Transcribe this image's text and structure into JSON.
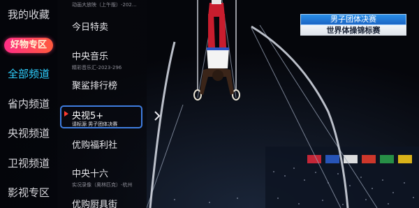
{
  "categories": [
    {
      "label": "我的收藏",
      "active": false
    },
    {
      "label": "全部频道",
      "active": true
    },
    {
      "label": "省内频道",
      "active": false
    },
    {
      "label": "央视频道",
      "active": false
    },
    {
      "label": "卫视频道",
      "active": false
    },
    {
      "label": "影视专区",
      "active": false
    }
  ],
  "goods_badge": {
    "label": "好物专区"
  },
  "channel_list": {
    "top_sub": "动画大放映（上午版）-202...",
    "items": [
      {
        "name": "今日特卖",
        "sub": ""
      },
      {
        "name": "中央音乐",
        "sub": "精彩音乐汇-2023-296"
      },
      {
        "name": "聚鲨排行榜",
        "sub": ""
      },
      {
        "name": "优购福利社",
        "sub": ""
      },
      {
        "name": "中央十六",
        "sub": "实况录像（奥林匹克）-杭州"
      },
      {
        "name": "优购厨具街",
        "sub": ""
      }
    ],
    "selected": {
      "name": "央视5+",
      "sub": "请标源 男子团体决赛"
    }
  },
  "scoreboard": {
    "line1": "男子团体决赛",
    "line2": "世界体操锦标赛"
  },
  "icons": {
    "play": "play-indicator-icon",
    "expand": "chevron-right-icon"
  },
  "colors": {
    "active_category": "#2fd0ff",
    "focus_border": "#3f7de0",
    "goods_badge": "#ff2d86"
  }
}
